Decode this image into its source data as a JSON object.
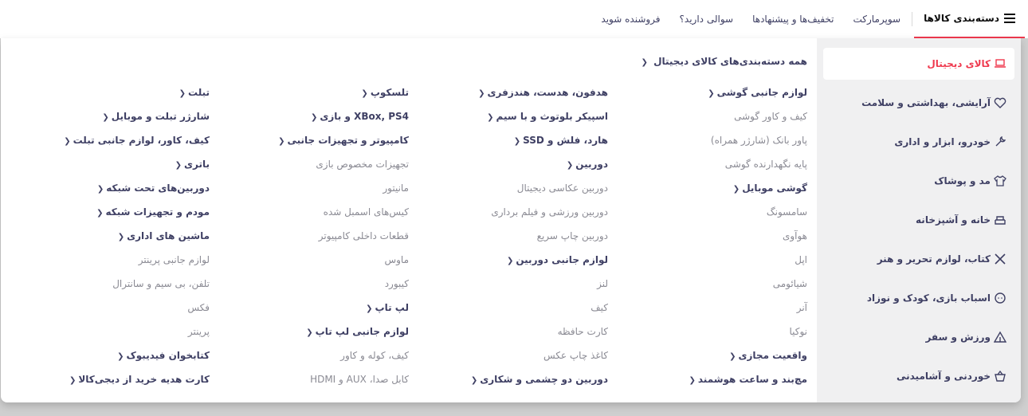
{
  "nav": {
    "categories": "دسته‌بندی کالاها",
    "supermarket": "سوپرمارکت",
    "offers": "تخفیف‌ها و پیشنهادها",
    "faq": "سوالی دارید؟",
    "seller": "فروشنده شوید"
  },
  "sidebar": [
    {
      "label": "کالای دیجیتال",
      "icon": "laptop-icon",
      "active": true
    },
    {
      "label": "آرایشی، بهداشتی و سلامت",
      "icon": "heart-icon"
    },
    {
      "label": "خودرو، ابزار و اداری",
      "icon": "wrench-icon"
    },
    {
      "label": "مد و پوشاک",
      "icon": "shirt-icon"
    },
    {
      "label": "خانه و آشپزخانه",
      "icon": "sofa-icon"
    },
    {
      "label": "کتاب، لوازم تحریر و هنر",
      "icon": "pencil-cross-icon"
    },
    {
      "label": "اسباب بازی، کودک و نوزاد",
      "icon": "baby-icon"
    },
    {
      "label": "ورزش و سفر",
      "icon": "tent-icon"
    },
    {
      "label": "خوردنی و آشامیدنی",
      "icon": "basket-icon"
    }
  ],
  "all_link": "همه دسته‌بندی‌های کالای دیجیتال",
  "columns": [
    [
      {
        "t": "لوازم جانبی گوشی",
        "h": true
      },
      {
        "t": "کیف و کاور گوشی"
      },
      {
        "t": "پاور بانک (شارژر همراه)"
      },
      {
        "t": "پایه نگهدارنده گوشی"
      },
      {
        "t": "گوشی موبایل",
        "h": true
      },
      {
        "t": "سامسونگ"
      },
      {
        "t": "هوآوی"
      },
      {
        "t": "اپل"
      },
      {
        "t": "شیائومی"
      },
      {
        "t": "آنر"
      },
      {
        "t": "نوکیا"
      },
      {
        "t": "واقعیت مجازی",
        "h": true
      },
      {
        "t": "مچ‌بند و ساعت هوشمند",
        "h": true
      }
    ],
    [
      {
        "t": "هدفون، هدست، هندزفری",
        "h": true
      },
      {
        "t": "اسپیکر بلوتوث و با سیم",
        "h": true
      },
      {
        "t": "هارد، فلش و SSD",
        "h": true
      },
      {
        "t": "دوربین",
        "h": true
      },
      {
        "t": "دوربین عکاسی دیجیتال"
      },
      {
        "t": "دوربین ورزشی و فیلم برداری"
      },
      {
        "t": "دوربین چاپ سریع"
      },
      {
        "t": "لوازم جانبی دوربین",
        "h": true
      },
      {
        "t": "لنز"
      },
      {
        "t": "کیف"
      },
      {
        "t": "کارت حافظه"
      },
      {
        "t": "کاغذ چاپ عکس"
      },
      {
        "t": "دوربین دو چشمی و شکاری",
        "h": true
      }
    ],
    [
      {
        "t": "تلسکوپ",
        "h": true
      },
      {
        "t": "XBox, PS4 و بازی",
        "h": true
      },
      {
        "t": "کامپیوتر و تجهیزات جانبی",
        "h": true
      },
      {
        "t": "تجهیزات مخصوص بازی"
      },
      {
        "t": "مانیتور"
      },
      {
        "t": "کیس‌های اسمبل شده"
      },
      {
        "t": "قطعات داخلی کامپیوتر"
      },
      {
        "t": "ماوس"
      },
      {
        "t": "کیبورد"
      },
      {
        "t": "لپ تاپ",
        "h": true
      },
      {
        "t": "لوازم جانبی لپ تاپ",
        "h": true
      },
      {
        "t": "کیف، کوله و کاور"
      },
      {
        "t": "کابل صدا، AUX و HDMI"
      }
    ],
    [
      {
        "t": "تبلت",
        "h": true
      },
      {
        "t": "شارژر تبلت و موبایل",
        "h": true
      },
      {
        "t": "کیف، کاور، لوازم جانبی تبلت",
        "h": true
      },
      {
        "t": "باتری",
        "h": true
      },
      {
        "t": "دوربین‌های تحت شبکه",
        "h": true
      },
      {
        "t": "مودم و تجهیزات شبکه",
        "h": true
      },
      {
        "t": "ماشین های اداری",
        "h": true
      },
      {
        "t": "لوازم جانبی پرینتر"
      },
      {
        "t": "تلفن، بی سیم و سانترال"
      },
      {
        "t": "فکس"
      },
      {
        "t": "پرینتر"
      },
      {
        "t": "کتابخوان فیدیبوک",
        "h": true
      },
      {
        "t": "کارت هدیه خرید از دیجی‌کالا",
        "h": true
      }
    ]
  ],
  "colors": {
    "accent": "#ef394e",
    "text": "#3f4064",
    "muted": "#8a8a93",
    "sidebar_bg": "#f0f0f1"
  }
}
